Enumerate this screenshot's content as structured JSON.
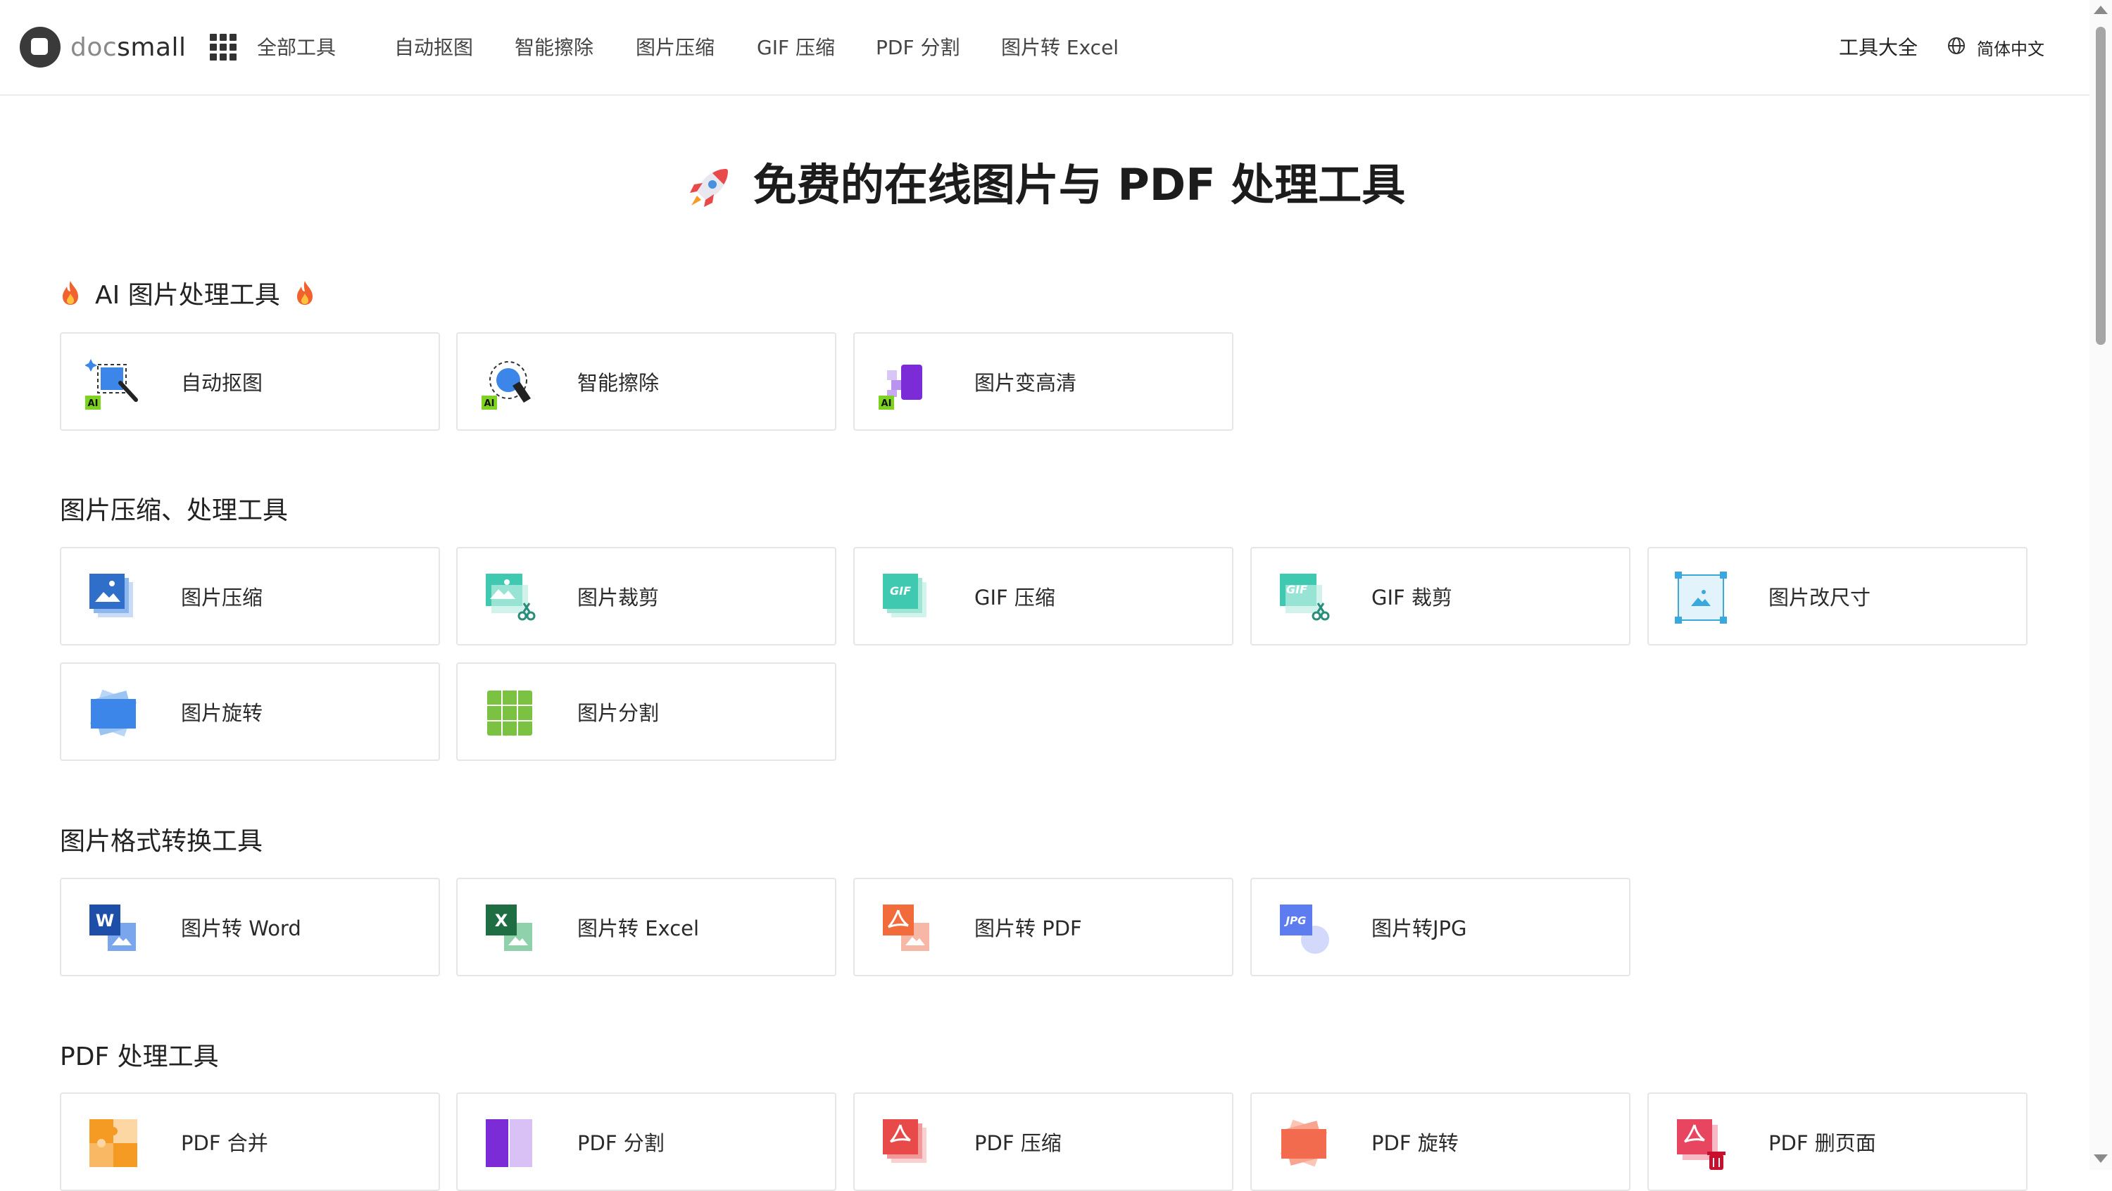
{
  "brand": {
    "doc": "doc",
    "small": "small"
  },
  "nav": {
    "all_tools": "全部工具",
    "items": [
      "自动抠图",
      "智能擦除",
      "图片压缩",
      "GIF 压缩",
      "PDF 分割",
      "图片转 Excel"
    ],
    "tools_all": "工具大全",
    "language": "简体中文"
  },
  "hero": {
    "title": "免费的在线图片与 PDF 处理工具"
  },
  "sections": [
    {
      "title": "AI 图片处理工具",
      "cards": [
        "自动抠图",
        "智能擦除",
        "图片变高清"
      ]
    },
    {
      "title": "图片压缩、处理工具",
      "cards": [
        "图片压缩",
        "图片裁剪",
        "GIF 压缩",
        "GIF 裁剪",
        "图片改尺寸",
        "图片旋转",
        "图片分割"
      ]
    },
    {
      "title": "图片格式转换工具",
      "cards": [
        "图片转 Word",
        "图片转 Excel",
        "图片转 PDF",
        "图片转JPG"
      ]
    },
    {
      "title": "PDF 处理工具",
      "cards": [
        "PDF 合并",
        "PDF 分割",
        "PDF 压缩",
        "PDF 旋转",
        "PDF 删页面"
      ]
    }
  ],
  "icon_text": {
    "ai": "AI",
    "gif": "GIF",
    "word": "W",
    "excel": "X",
    "jpg": "JPG"
  },
  "colors": {
    "blue": "#3b86e8",
    "purple": "#7b2cd6",
    "teal": "#3ec9b0",
    "green": "#7cc242",
    "word": "#1d4fa8",
    "excel": "#1f6e43",
    "pdf_red": "#e84a4a",
    "orange": "#f59a23"
  }
}
